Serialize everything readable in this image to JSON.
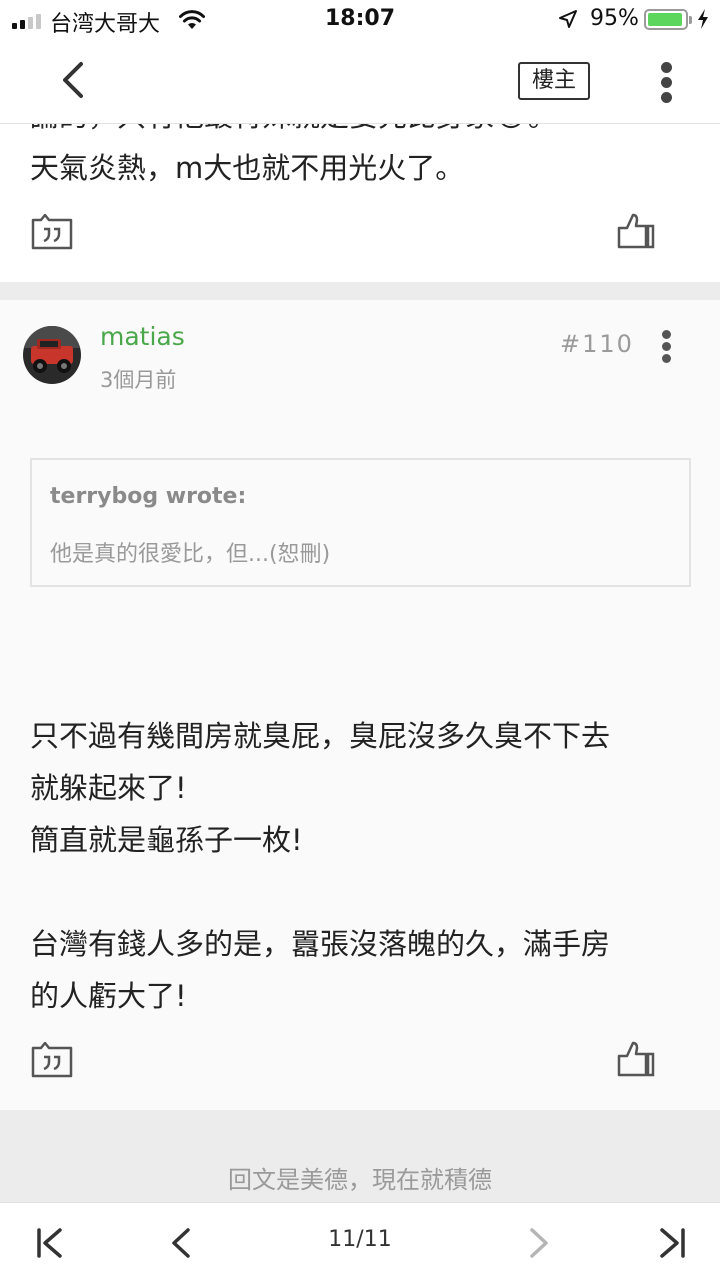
{
  "status_bar": {
    "carrier": "台湾大哥大",
    "time": "18:07",
    "battery": "95%",
    "battery_level": 0.95,
    "signal_bars": 2,
    "icons": [
      "signal-icon",
      "wifi-icon",
      "location-arrow-icon",
      "battery-icon",
      "charging-bolt-icon"
    ]
  },
  "header": {
    "back_icon": "chevron-left-icon",
    "op_filter_label": "樓主",
    "more_icon": "vertical-dots-icon"
  },
  "previous_post": {
    "cut_line": "論的，只有他最特殊就是要先比身家😂。",
    "last_line": "天氣炎熱，m大也就不用光火了。",
    "quote_icon": "quote-icon",
    "like_icon": "thumbs-up-icon"
  },
  "post": {
    "author": "matias",
    "time_ago": "3個月前",
    "floor": "#110",
    "more_icon": "vertical-dots-icon",
    "avatar_icon": "red-jeep-avatar",
    "quote": {
      "author_line": "terrybog wrote:",
      "text": "他是真的很愛比，但...(恕刪)"
    },
    "body_lines": [
      "只不過有幾間房就臭屁，臭屁沒多久臭不下去",
      "就躲起來了!",
      "簡直就是龜孫子一枚!",
      "",
      "台灣有錢人多的是，囂張沒落魄的久，滿手房",
      "的人虧大了!"
    ],
    "quote_icon": "quote-icon",
    "like_icon": "thumbs-up-icon"
  },
  "cta": {
    "text": "回文是美德，現在就積德"
  },
  "pager": {
    "page_label": "11/11",
    "first_icon": "first-page-icon",
    "prev_icon": "chevron-left-icon",
    "next_icon": "chevron-right-icon",
    "last_icon": "last-page-icon"
  },
  "colors": {
    "username": "#4aa84a",
    "battery_fill": "#5cd65c",
    "band": "#ececec",
    "muted_text": "#9a9a9a"
  }
}
